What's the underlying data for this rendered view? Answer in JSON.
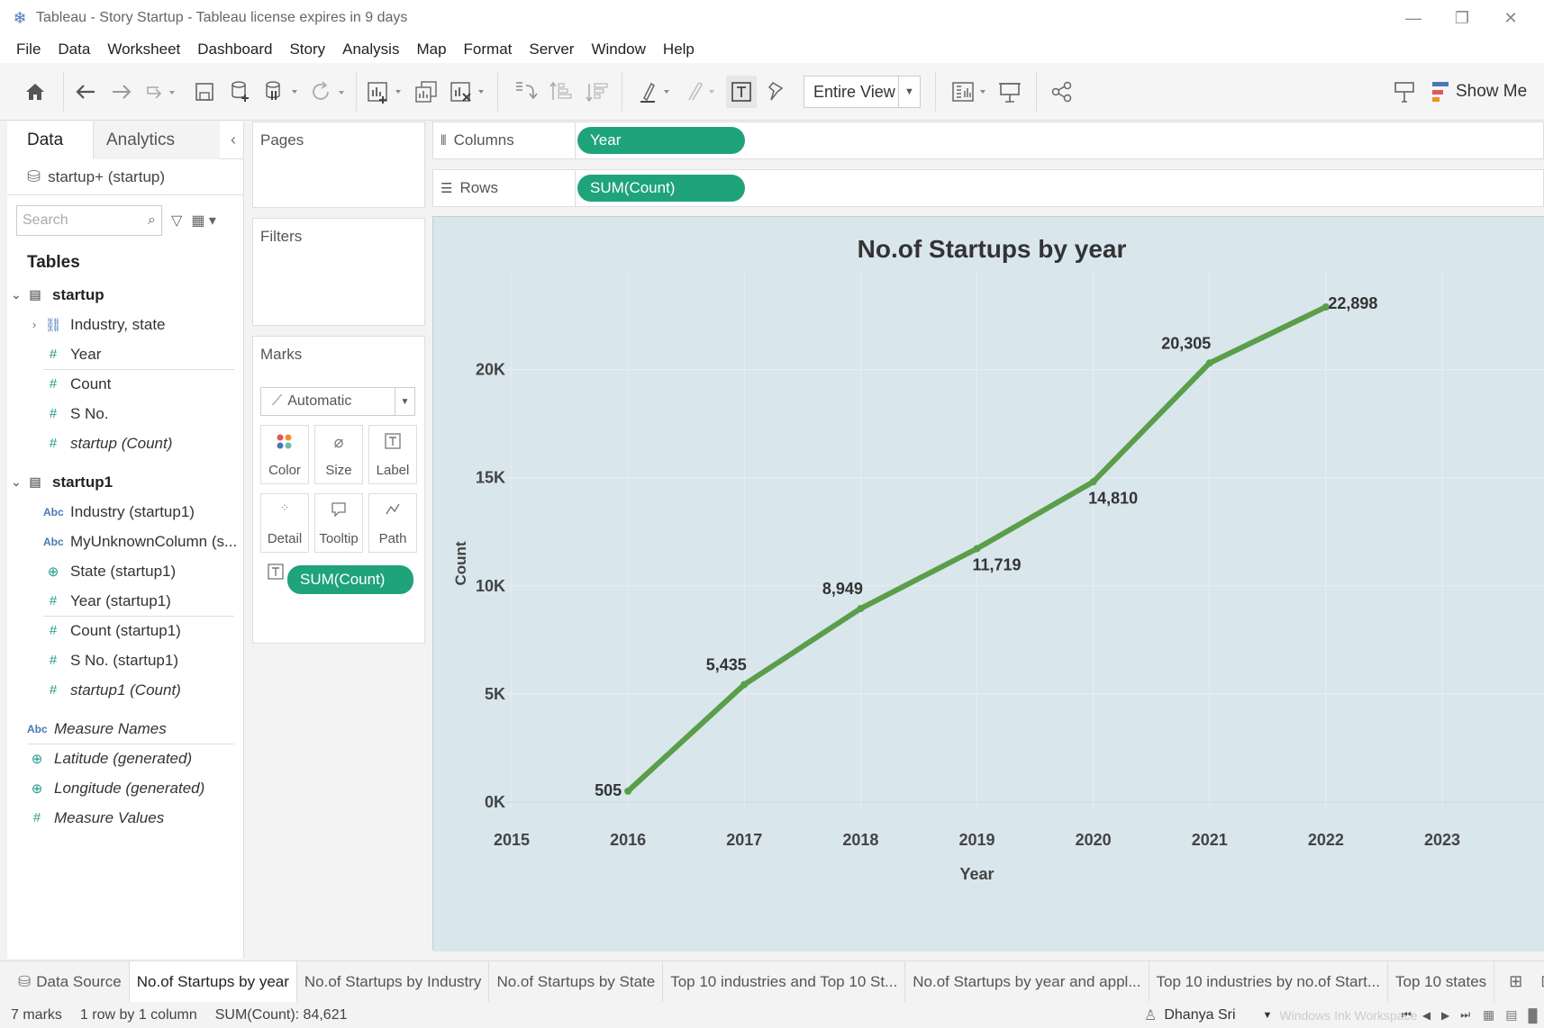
{
  "window": {
    "title": "Tableau - Story Startup - Tableau license expires in 9 days",
    "controls": [
      "—",
      "❐",
      "✕"
    ]
  },
  "menu": [
    "File",
    "Data",
    "Worksheet",
    "Dashboard",
    "Story",
    "Analysis",
    "Map",
    "Format",
    "Server",
    "Window",
    "Help"
  ],
  "toolbar": {
    "fit": "Entire View",
    "show_me": "Show Me",
    "show_me_colors": [
      "#4a78b5",
      "#e15759",
      "#f28e2b"
    ]
  },
  "data_pane": {
    "tab_data": "Data",
    "tab_analytics": "Analytics",
    "datasource": "startup+ (startup)",
    "search_placeholder": "Search",
    "tables_heading": "Tables",
    "tables": [
      {
        "name": "startup",
        "fields": [
          {
            "icon": "hierarchy",
            "label": "Industry, state"
          },
          {
            "icon": "#",
            "label": "Year"
          },
          {
            "icon": "#",
            "label": "Count"
          },
          {
            "icon": "#",
            "label": "S No."
          },
          {
            "icon": "#",
            "label": "startup (Count)"
          }
        ]
      },
      {
        "name": "startup1",
        "fields": [
          {
            "icon": "Abc",
            "label": "Industry (startup1)"
          },
          {
            "icon": "Abc",
            "label": "MyUnknownColumn (s..."
          },
          {
            "icon": "globe",
            "label": "State (startup1)"
          },
          {
            "icon": "#",
            "label": "Year (startup1)"
          },
          {
            "icon": "#",
            "label": "Count (startup1)"
          },
          {
            "icon": "#",
            "label": "S No. (startup1)"
          },
          {
            "icon": "#",
            "label": "startup1 (Count)"
          }
        ]
      }
    ],
    "extra_fields": [
      {
        "icon": "Abc",
        "label": "Measure Names"
      },
      {
        "icon": "globe",
        "label": "Latitude (generated)"
      },
      {
        "icon": "globe",
        "label": "Longitude (generated)"
      },
      {
        "icon": "#",
        "label": "Measure Values"
      }
    ]
  },
  "cards": {
    "pages": "Pages",
    "filters": "Filters",
    "marks": "Marks",
    "mark_type": "Automatic",
    "mark_buttons": [
      "Color",
      "Size",
      "Label",
      "Detail",
      "Tooltip",
      "Path"
    ],
    "mark_pill": "SUM(Count)"
  },
  "shelves": {
    "columns_label": "Columns",
    "columns_pill": "Year",
    "rows_label": "Rows",
    "rows_pill": "SUM(Count)"
  },
  "pill_color": "#1fa37a",
  "chart_data": {
    "type": "line",
    "title": "No.of Startups by year",
    "xlabel": "Year",
    "ylabel": "Count",
    "x": [
      2016,
      2017,
      2018,
      2019,
      2020,
      2021,
      2022
    ],
    "series": [
      {
        "values": [
          505,
          5435,
          8949,
          11719,
          14810,
          20305,
          22898
        ],
        "color": "#5a9e4a"
      }
    ],
    "data_labels": [
      "505",
      "5,435",
      "8,949",
      "11,719",
      "14,810",
      "20,305",
      "22,898"
    ],
    "xlim": [
      2015,
      2023
    ],
    "ylim": [
      0,
      22898
    ],
    "x_ticks": [
      "2015",
      "2016",
      "2017",
      "2018",
      "2019",
      "2020",
      "2021",
      "2022",
      "2023"
    ],
    "y_ticks": [
      {
        "value": 0,
        "label": "0K"
      },
      {
        "value": 5000,
        "label": "5K"
      },
      {
        "value": 10000,
        "label": "10K"
      },
      {
        "value": 15000,
        "label": "15K"
      },
      {
        "value": 20000,
        "label": "20K"
      }
    ],
    "grid": true,
    "background": "#d9e6ec"
  },
  "sheet_tabs": {
    "data_source": "Data Source",
    "tabs": [
      "No.of Startups by year",
      "No.of Startups by Industry",
      "No.of Startups by State",
      "Top 10 industries and Top 10 St...",
      "No.of Startups by year and appl...",
      "Top 10 industries by no.of Start...",
      "Top 10 states"
    ],
    "active_index": 0
  },
  "status": {
    "marks": "7 marks",
    "dims": "1 row by 1 column",
    "sum": "SUM(Count): 84,621",
    "user": "Dhanya Sri",
    "watermark": "Windows Ink Workspace"
  }
}
